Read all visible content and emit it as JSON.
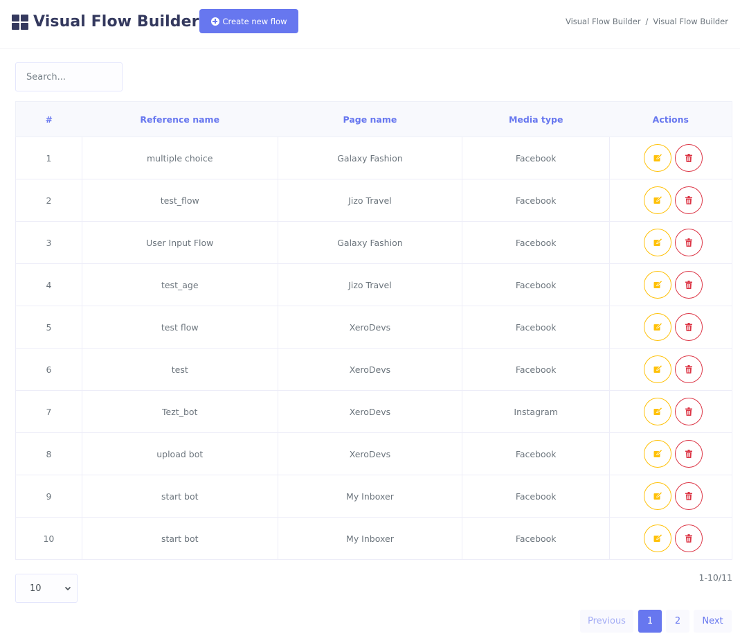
{
  "header": {
    "title": "Visual Flow Builder",
    "create_button": "Create new flow",
    "breadcrumb": [
      "Visual Flow Builder",
      "Visual Flow Builder"
    ],
    "breadcrumb_separator": "/"
  },
  "search": {
    "placeholder": "Search...",
    "value": ""
  },
  "table": {
    "columns": [
      "#",
      "Reference name",
      "Page name",
      "Media type",
      "Actions"
    ],
    "rows": [
      {
        "num": "1",
        "reference": "multiple choice",
        "page": "Galaxy Fashion",
        "media": "Facebook"
      },
      {
        "num": "2",
        "reference": "test_flow",
        "page": "Jizo Travel",
        "media": "Facebook"
      },
      {
        "num": "3",
        "reference": "User Input Flow",
        "page": "Galaxy Fashion",
        "media": "Facebook"
      },
      {
        "num": "4",
        "reference": "test_age",
        "page": "Jizo Travel",
        "media": "Facebook"
      },
      {
        "num": "5",
        "reference": "test flow",
        "page": "XeroDevs",
        "media": "Facebook"
      },
      {
        "num": "6",
        "reference": "test",
        "page": "XeroDevs",
        "media": "Facebook"
      },
      {
        "num": "7",
        "reference": "Tezt_bot",
        "page": "XeroDevs",
        "media": "Instagram"
      },
      {
        "num": "8",
        "reference": "upload bot",
        "page": "XeroDevs",
        "media": "Facebook"
      },
      {
        "num": "9",
        "reference": "start bot",
        "page": "My Inboxer",
        "media": "Facebook"
      },
      {
        "num": "10",
        "reference": "start bot",
        "page": "My Inboxer",
        "media": "Facebook"
      }
    ],
    "action_icons": [
      "edit-icon",
      "trash-icon"
    ]
  },
  "footer": {
    "per_page": "10",
    "count_text": "1-10/11",
    "pagination": {
      "previous": "Previous",
      "pages": [
        "1",
        "2"
      ],
      "active_page": "1",
      "next": "Next"
    }
  },
  "colors": {
    "primary": "#6777ef",
    "title": "#34395e",
    "edit": "#ffc107",
    "delete": "#dc3545"
  }
}
